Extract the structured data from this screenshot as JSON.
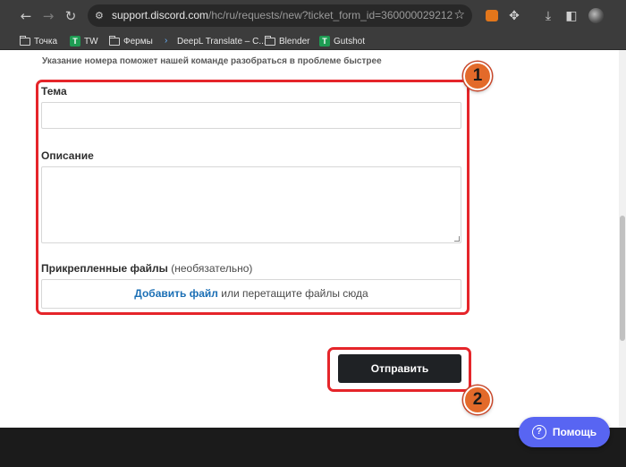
{
  "browser": {
    "url_host": "support.discord.com",
    "url_path": "/hc/ru/requests/new?ticket_form_id=360000029212",
    "bookmarks": [
      {
        "label": "Точка",
        "icon": "folder-icon"
      },
      {
        "label": "TW",
        "icon": "tw-icon"
      },
      {
        "label": "Фермы",
        "icon": "folder-icon"
      },
      {
        "label": "DeepL Translate – C...",
        "icon": "deepl-icon"
      },
      {
        "label": "Blender",
        "icon": "folder-icon"
      },
      {
        "label": "Gutshot",
        "icon": "tw-icon"
      }
    ]
  },
  "form": {
    "hint": "Указание номера поможет нашей команде разобраться в проблеме быстрее",
    "subject_label": "Тема",
    "subject_value": "",
    "description_label": "Описание",
    "description_value": "",
    "attachments_label": "Прикрепленные файлы",
    "attachments_optional": "(необязательно)",
    "add_file_link": "Добавить файл",
    "drop_text": "или перетащите файлы сюда",
    "submit_label": "Отправить"
  },
  "help_button": {
    "label": "Помощь"
  },
  "annotations": {
    "step1": "1",
    "step2": "2",
    "highlight_color": "#e5252a",
    "badge_color": "#e36a2a"
  },
  "colors": {
    "discord_blurple": "#5865f2",
    "link_blue": "#1b6fb5",
    "submit_bg": "#1f2225"
  }
}
